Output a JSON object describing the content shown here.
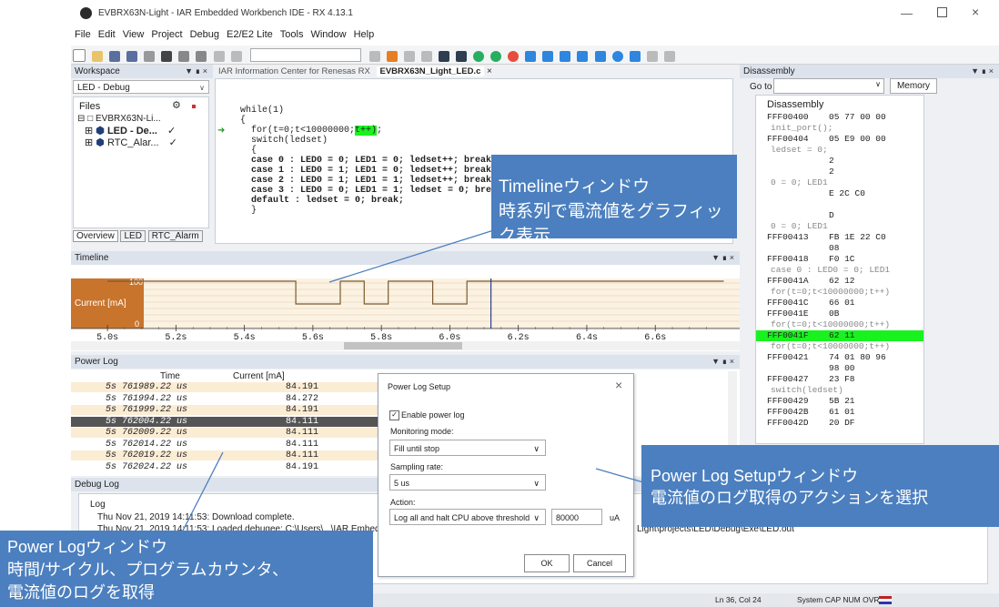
{
  "window": {
    "title": "EVBRX63N-Light - IAR Embedded Workbench IDE - RX 4.13.1"
  },
  "menu": [
    "File",
    "Edit",
    "View",
    "Project",
    "Debug",
    "E2/E2 Lite",
    "Tools",
    "Window",
    "Help"
  ],
  "workspace": {
    "title": "Workspace",
    "config": "LED - Debug",
    "files_label": "Files",
    "tree": [
      {
        "label": "EVBRX63N-Li..."
      },
      {
        "label": "LED - De...",
        "check": "✓"
      },
      {
        "label": "RTC_Alar...",
        "check": "✓"
      }
    ],
    "tabs": [
      "Overview",
      "LED",
      "RTC_Alarm"
    ]
  },
  "editor": {
    "tabs": [
      "IAR Information Center for Renesas RX",
      "EVBRX63N_Light_LED.c"
    ],
    "lines": [
      "while(1)",
      "{",
      "  for(t=0;t<10000000;t++);",
      "",
      "  switch(ledset)",
      "  {",
      "  case 0 : LED0 = 0; LED1 = 0; ledset++; break;",
      "  case 1 : LED0 = 1; LED1 = 0; ledset++; break;",
      "  case 2 : LED0 = 1; LED1 = 1; ledset++; break;",
      "  case 3 : LED0 = 0; LED1 = 1; ledset = 0; break;",
      "  default : ledset = 0; break;",
      "  }"
    ]
  },
  "disassembly": {
    "title": "Disassembly",
    "goto_label": "Go to",
    "memory_label": "Memory",
    "header": "Disassembly",
    "lines": [
      {
        "addr": "FFF00400",
        "bytes": "05 77 00 00",
        "kind": "asm"
      },
      {
        "text": "init_port();",
        "kind": "src"
      },
      {
        "addr": "FFF00404",
        "bytes": "05 E9 00 00",
        "kind": "asm"
      },
      {
        "text": "ledset = 0;",
        "kind": "src"
      },
      {
        "addr": "",
        "bytes": "2",
        "kind": "asm"
      },
      {
        "addr": "",
        "bytes": "2",
        "kind": "asm"
      },
      {
        "text": "0 = 0; LED1",
        "kind": "src"
      },
      {
        "addr": "",
        "bytes": "E 2C C0",
        "kind": "asm"
      },
      {
        "addr": "",
        "bytes": "",
        "kind": "asm"
      },
      {
        "addr": "",
        "bytes": "D",
        "kind": "asm"
      },
      {
        "text": "0 = 0; LED1",
        "kind": "src"
      },
      {
        "addr": "FFF00413",
        "bytes": "FB 1E 22 C0",
        "kind": "asm"
      },
      {
        "addr": "",
        "bytes": "08",
        "kind": "asm"
      },
      {
        "addr": "FFF00418",
        "bytes": "F0 1C",
        "kind": "asm"
      },
      {
        "text": "case 0 : LED0 = 0; LED1",
        "kind": "src"
      },
      {
        "addr": "FFF0041A",
        "bytes": "62 12",
        "kind": "asm"
      },
      {
        "text": "for(t=0;t<10000000;t++)",
        "kind": "src"
      },
      {
        "addr": "FFF0041C",
        "bytes": "66 01",
        "kind": "asm"
      },
      {
        "addr": "FFF0041E",
        "bytes": "0B",
        "kind": "asm"
      },
      {
        "text": "for(t=0;t<10000000;t++)",
        "kind": "src"
      },
      {
        "addr": "FFF0041F",
        "bytes": "62 11",
        "kind": "hl"
      },
      {
        "text": "for(t=0;t<10000000;t++)",
        "kind": "src"
      },
      {
        "addr": "FFF00421",
        "bytes": "74 01 80 96",
        "kind": "asm"
      },
      {
        "addr": "",
        "bytes": "98 00",
        "kind": "asm"
      },
      {
        "addr": "FFF00427",
        "bytes": "23 F8",
        "kind": "asm"
      },
      {
        "text": "switch(ledset)",
        "kind": "src"
      },
      {
        "addr": "FFF00429",
        "bytes": "5B 21",
        "kind": "asm"
      },
      {
        "addr": "FFF0042B",
        "bytes": "61 01",
        "kind": "asm"
      },
      {
        "addr": "FFF0042D",
        "bytes": "20 DF",
        "kind": "asm"
      }
    ]
  },
  "timeline": {
    "title": "Timeline",
    "y_max": "100",
    "y_min": "0",
    "channel_label": "Current [mA]",
    "ticks": [
      "5.0s",
      "5.2s",
      "5.4s",
      "5.6s",
      "5.8s",
      "6.0s",
      "6.2s",
      "6.4s",
      "6.6s"
    ],
    "signal": [
      {
        "t": 5.0,
        "v": 100
      },
      {
        "t": 5.55,
        "v": 100
      },
      {
        "t": 5.55,
        "v": 52
      },
      {
        "t": 5.68,
        "v": 52
      },
      {
        "t": 5.68,
        "v": 100
      },
      {
        "t": 5.75,
        "v": 100
      },
      {
        "t": 5.75,
        "v": 52
      },
      {
        "t": 5.82,
        "v": 52
      },
      {
        "t": 5.82,
        "v": 100
      },
      {
        "t": 5.95,
        "v": 100
      },
      {
        "t": 5.95,
        "v": 52
      },
      {
        "t": 6.05,
        "v": 52
      },
      {
        "t": 6.05,
        "v": 100
      },
      {
        "t": 6.8,
        "v": 100
      }
    ]
  },
  "power_log": {
    "title": "Power Log",
    "col_time": "Time",
    "col_current": "Current [mA]",
    "rows": [
      {
        "time": "5s 761989.22 us",
        "current": "84.191"
      },
      {
        "time": "5s 761994.22 us",
        "current": "84.272"
      },
      {
        "time": "5s 761999.22 us",
        "current": "84.191"
      },
      {
        "time": "5s 762004.22 us",
        "current": "84.111"
      },
      {
        "time": "5s 762009.22 us",
        "current": "84.111"
      },
      {
        "time": "5s 762014.22 us",
        "current": "84.111"
      },
      {
        "time": "5s 762019.22 us",
        "current": "84.111"
      },
      {
        "time": "5s 762024.22 us",
        "current": "84.191"
      }
    ]
  },
  "debug_log": {
    "title": "Debug Log",
    "header": "Log",
    "lines": [
      "Thu Nov 21, 2019 14:11:53: Download complete.",
      "Thu Nov 21, 2019 14:11:53: Loaded debugee: C:\\Users\\...\\IAR Embedd"
    ],
    "path_tail": "Light\\projects\\LED\\Debug\\Exe\\LED.out"
  },
  "dialog": {
    "title": "Power Log Setup",
    "enable_label": "Enable power log",
    "monitoring_label": "Monitoring mode:",
    "monitoring_value": "Fill until stop",
    "sampling_label": "Sampling rate:",
    "sampling_value": "5 us",
    "action_label": "Action:",
    "action_value": "Log all and halt CPU above threshold",
    "threshold_value": "80000",
    "threshold_unit": "uA",
    "ok_label": "OK",
    "cancel_label": "Cancel"
  },
  "statusbar": {
    "position": "Ln 36, Col 24",
    "indicators": "System CAP NUM OVR"
  },
  "callouts": {
    "timeline_l1": "Timelineウィンドウ",
    "timeline_l2": "時系列で電流値をグラフィック表示",
    "setup_l1": "Power Log Setupウィンドウ",
    "setup_l2": "電流値のログ取得のアクションを選択",
    "powerlog_l1": "Power Logウィンドウ",
    "powerlog_l2": "時間/サイクル、プログラムカウンタ、",
    "powerlog_l3": "電流値のログを取得"
  },
  "colors": {
    "accent": "#4b7fbf",
    "highlight": "#19f21f",
    "timeline_fill": "#c8742d"
  }
}
